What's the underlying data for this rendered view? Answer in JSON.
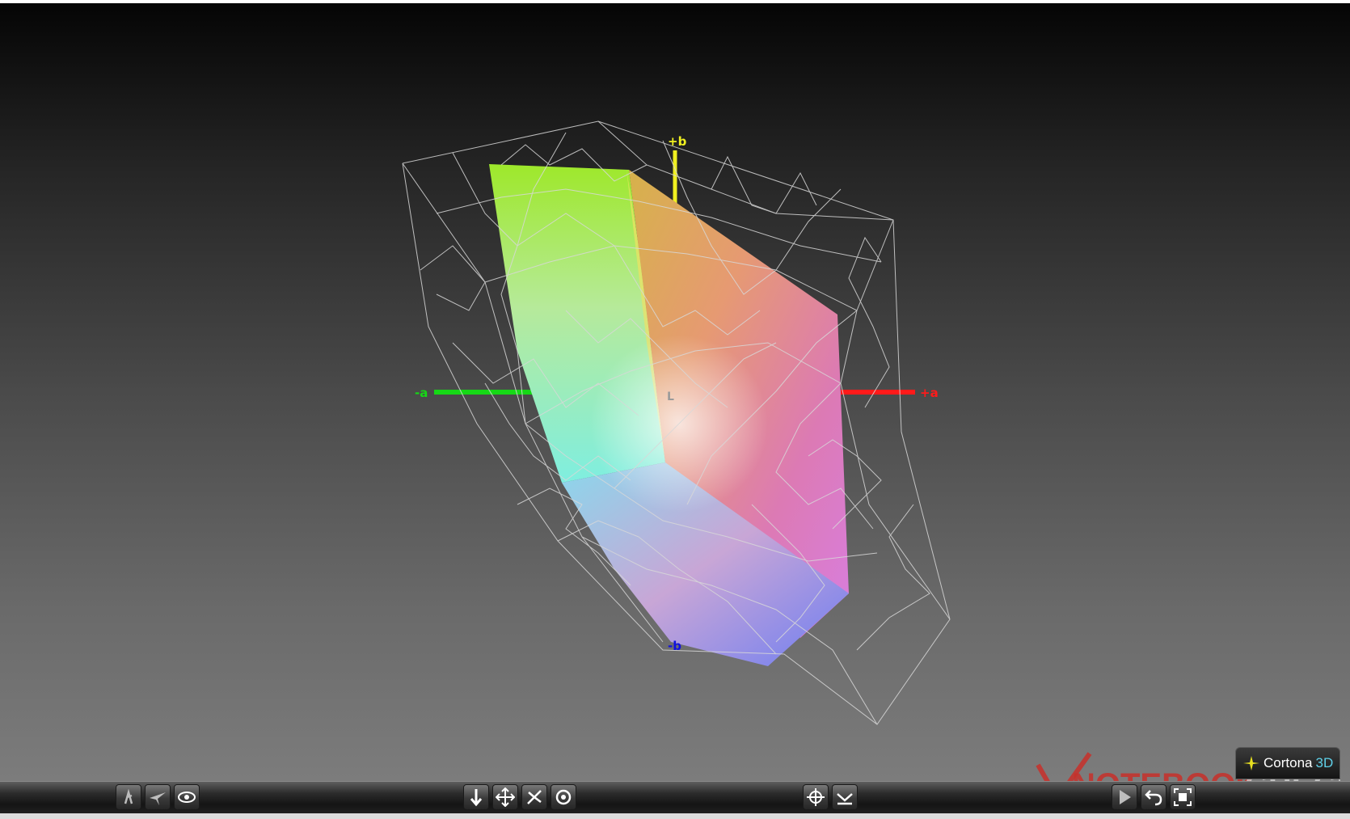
{
  "axes": {
    "plus_b": "+b",
    "minus_b": "-b",
    "plus_a": "+a",
    "minus_a": "-a",
    "lightness_marker": "L"
  },
  "colors": {
    "axis_plus_b": "#f0f020",
    "axis_minus_b": "#1010e0",
    "axis_plus_a": "#ff1a1a",
    "axis_minus_a": "#16d816",
    "wireframe": "#d8d8d8"
  },
  "toolbar": {
    "left_group": [
      {
        "icon": "walk-icon",
        "name": "walk-button"
      },
      {
        "icon": "fly-icon",
        "name": "fly-button"
      },
      {
        "icon": "eye-icon",
        "name": "study-button"
      }
    ],
    "center_group": [
      {
        "icon": "move-vertical-icon",
        "name": "slide-button"
      },
      {
        "icon": "pan-icon",
        "name": "pan-button"
      },
      {
        "icon": "turn-icon",
        "name": "turn-button"
      },
      {
        "icon": "rotate-icon",
        "name": "rotate-button"
      }
    ],
    "right_group": [
      {
        "icon": "target-icon",
        "name": "goto-button"
      },
      {
        "icon": "align-icon",
        "name": "align-button"
      }
    ],
    "far_right_group": [
      {
        "icon": "play-icon",
        "name": "play-button"
      },
      {
        "icon": "undo-icon",
        "name": "restore-button"
      },
      {
        "icon": "fit-icon",
        "name": "fit-button"
      }
    ]
  },
  "brand": {
    "name": "Cortona",
    "suffix": "3D"
  },
  "watermark": {
    "text_a": "NOTEBOOK",
    "text_b": "CHECK"
  }
}
